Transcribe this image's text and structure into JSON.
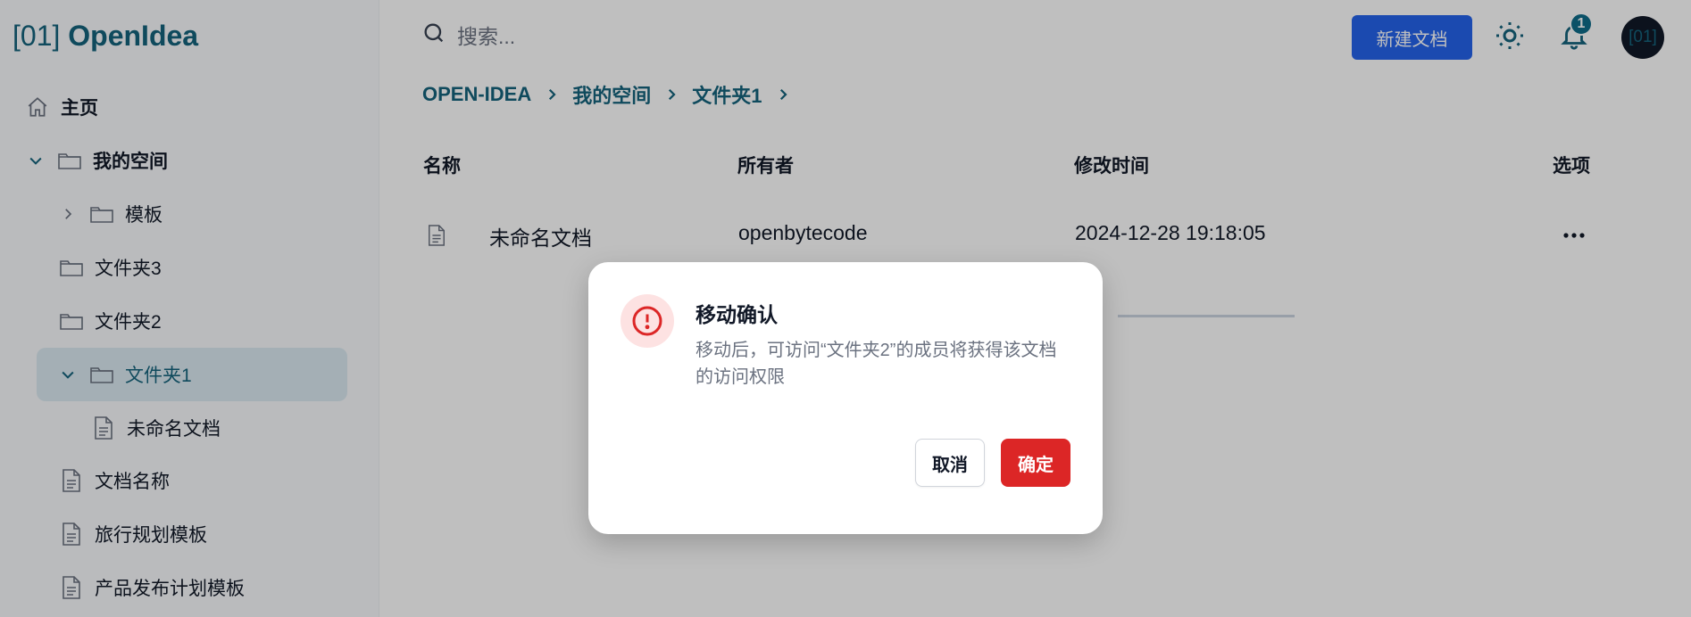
{
  "app": {
    "logo_bracket": "[01]",
    "logo_name": "OpenIdea"
  },
  "sidebar": {
    "items": [
      {
        "label": "主页",
        "icon": "home-icon"
      },
      {
        "label": "我的空间",
        "icon": "folder-icon",
        "expanded": true
      },
      {
        "label": "模板",
        "icon": "folder-icon",
        "expanded": false
      },
      {
        "label": "文件夹3",
        "icon": "folder-icon"
      },
      {
        "label": "文件夹2",
        "icon": "folder-icon"
      },
      {
        "label": "文件夹1",
        "icon": "folder-icon",
        "expanded": true,
        "active": true
      },
      {
        "label": "未命名文档",
        "icon": "document-icon"
      },
      {
        "label": "文档名称",
        "icon": "document-icon"
      },
      {
        "label": "旅行规划模板",
        "icon": "document-icon"
      },
      {
        "label": "产品发布计划模板",
        "icon": "document-icon"
      }
    ]
  },
  "header": {
    "search_placeholder": "搜索...",
    "new_doc_label": "新建文档",
    "notification_count": "1",
    "avatar_text": "[01]"
  },
  "breadcrumb": [
    "OPEN-IDEA",
    "我的空间",
    "文件夹1"
  ],
  "table": {
    "headers": [
      "名称",
      "所有者",
      "修改时间",
      "选项"
    ],
    "rows": [
      {
        "name": "未命名文档",
        "owner": "openbytecode",
        "modified": "2024-12-28 19:18:05",
        "options": "..."
      }
    ]
  },
  "dialog": {
    "title": "移动确认",
    "description": "移动后，可访问“文件夹2”的成员将获得该文档的访问权限",
    "cancel_label": "取消",
    "confirm_label": "确定"
  },
  "colors": {
    "accent": "#15637c",
    "primary": "#2563eb",
    "danger": "#dc2626"
  }
}
